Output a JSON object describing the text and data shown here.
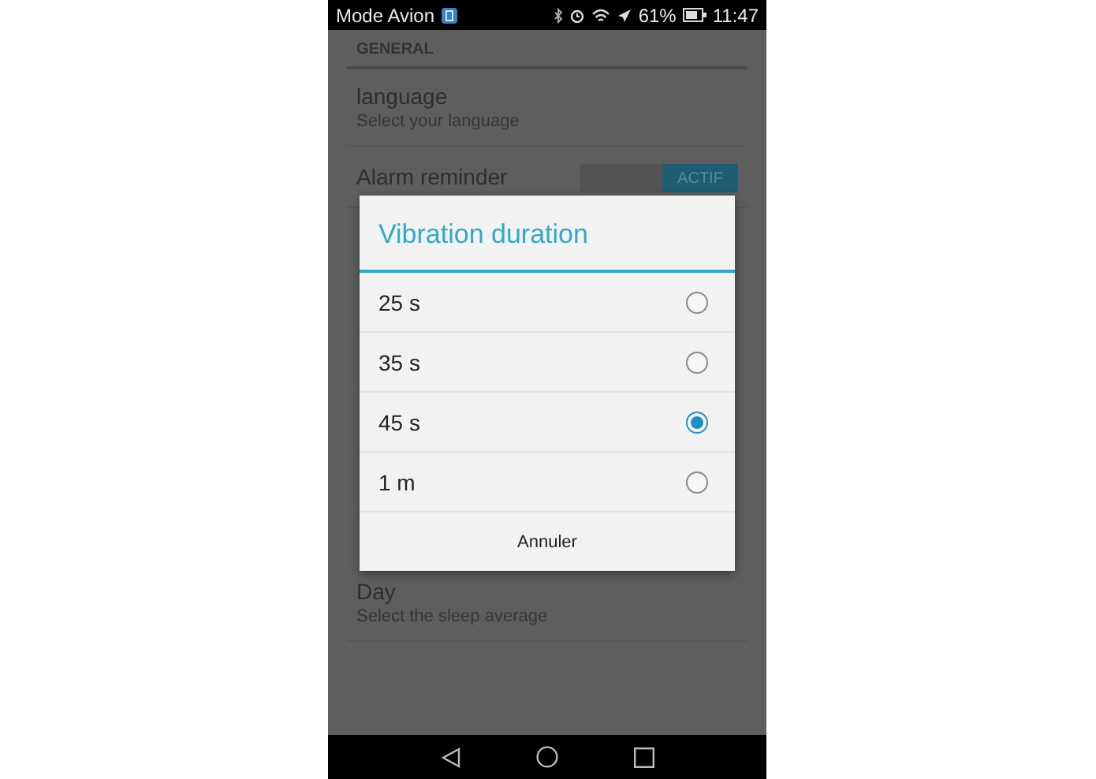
{
  "status_bar": {
    "carrier": "Mode Avion",
    "battery": "61%",
    "time": "11:47"
  },
  "settings": {
    "section": "GENERAL",
    "items": [
      {
        "kind": "text",
        "title": "language",
        "subtitle": "Select your language"
      },
      {
        "kind": "toggle",
        "title": "Alarm reminder",
        "toggle_label": "ACTIF",
        "on": true
      }
    ],
    "hidden_items": [
      {
        "title": "Day",
        "subtitle": "Select the sleep average"
      }
    ]
  },
  "dialog": {
    "title": "Vibration duration",
    "options": [
      {
        "label": "25 s",
        "selected": false
      },
      {
        "label": "35 s",
        "selected": false
      },
      {
        "label": "45 s",
        "selected": true
      },
      {
        "label": "1 m",
        "selected": false
      }
    ],
    "cancel": "Annuler"
  }
}
